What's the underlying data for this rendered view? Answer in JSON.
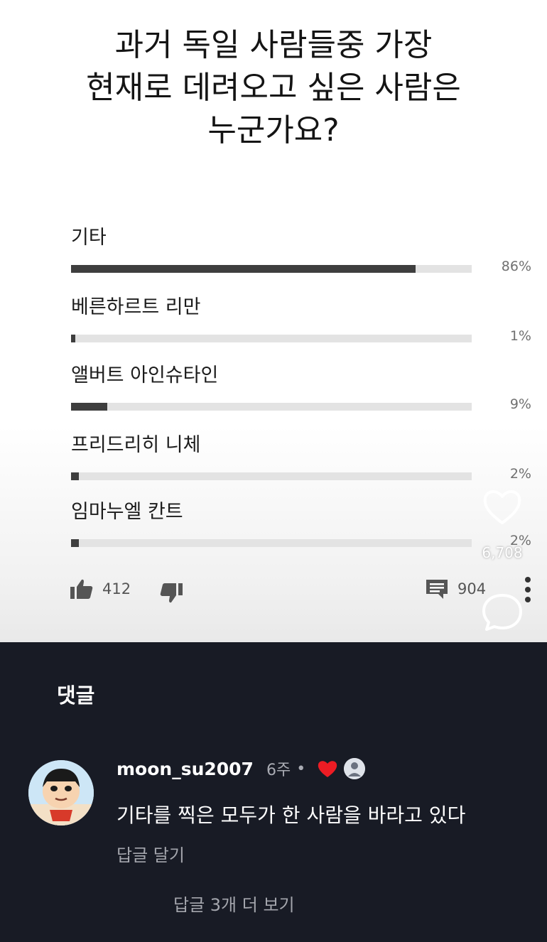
{
  "question": {
    "title": "과거 독일 사람들중 가장\n현재로 데려오고 싶은 사람은\n누군가요?"
  },
  "poll": {
    "options": [
      {
        "label": "기타",
        "percent_text": "86%",
        "fraction": 0.86
      },
      {
        "label": "베른하르트 리만",
        "percent_text": "1%",
        "fraction": 0.01
      },
      {
        "label": "앨버트 아인슈타인",
        "percent_text": "9%",
        "fraction": 0.09
      },
      {
        "label": "프리드리히 니체",
        "percent_text": "2%",
        "fraction": 0.02
      },
      {
        "label": "임마누엘 칸트",
        "percent_text": "2%",
        "fraction": 0.02
      }
    ]
  },
  "actions": {
    "like_icon": "thumbs-up-icon",
    "like_count": "412",
    "dislike_icon": "thumbs-down-icon",
    "comment_icon": "comment-icon",
    "comment_count": "904",
    "more_icon": "more-vertical-icon"
  },
  "overlay": {
    "heart_icon": "heart-outline-icon",
    "like_count": "6,708",
    "bubble_icon": "comment-bubble-icon"
  },
  "comments": {
    "heading": "댓글",
    "items": [
      {
        "username": "moon_su2007",
        "time": "6주",
        "separator": "•",
        "text": "기타를 찍은 모두가 한 사람을 바라고 있다",
        "reply_label": "답글 달기",
        "creator_heart_icon": "red-heart-icon"
      }
    ],
    "view_more_label": "답글 3개 더 보기"
  },
  "colors": {
    "bar_fill": "#3e3e3e",
    "bar_track": "#e3e3e3",
    "dark_background": "#181b25",
    "heart_red": "#ed1c24"
  }
}
